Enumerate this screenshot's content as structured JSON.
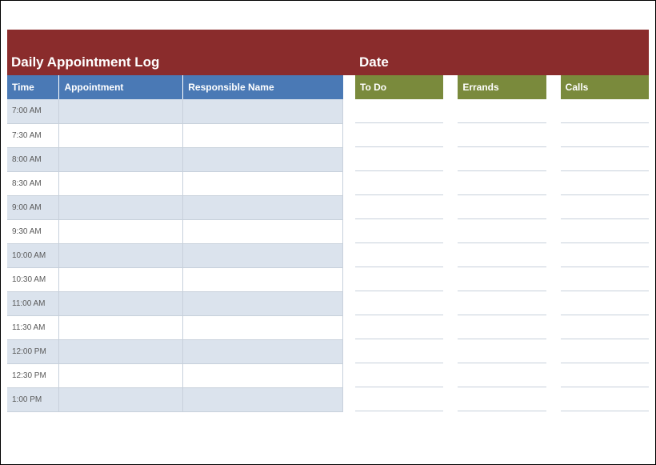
{
  "header": {
    "title": "Daily Appointment Log",
    "date_label": "Date"
  },
  "appointments": {
    "headers": {
      "time": "Time",
      "appointment": "Appointment",
      "responsible": "Responsible Name"
    },
    "rows": [
      {
        "time": "7:00 AM",
        "appointment": "",
        "responsible": ""
      },
      {
        "time": "7:30 AM",
        "appointment": "",
        "responsible": ""
      },
      {
        "time": "8:00 AM",
        "appointment": "",
        "responsible": ""
      },
      {
        "time": "8:30 AM",
        "appointment": "",
        "responsible": ""
      },
      {
        "time": "9:00 AM",
        "appointment": "",
        "responsible": ""
      },
      {
        "time": "9:30 AM",
        "appointment": "",
        "responsible": ""
      },
      {
        "time": "10:00 AM",
        "appointment": "",
        "responsible": ""
      },
      {
        "time": "10:30 AM",
        "appointment": "",
        "responsible": ""
      },
      {
        "time": "11:00 AM",
        "appointment": "",
        "responsible": ""
      },
      {
        "time": "11:30 AM",
        "appointment": "",
        "responsible": ""
      },
      {
        "time": "12:00 PM",
        "appointment": "",
        "responsible": ""
      },
      {
        "time": "12:30 PM",
        "appointment": "",
        "responsible": ""
      },
      {
        "time": "1:00 PM",
        "appointment": "",
        "responsible": ""
      }
    ]
  },
  "side": {
    "todo": {
      "label": "To Do",
      "rows": [
        "",
        "",
        "",
        "",
        "",
        "",
        "",
        "",
        "",
        "",
        "",
        "",
        ""
      ]
    },
    "errands": {
      "label": "Errands",
      "rows": [
        "",
        "",
        "",
        "",
        "",
        "",
        "",
        "",
        "",
        "",
        "",
        "",
        ""
      ]
    },
    "calls": {
      "label": "Calls",
      "rows": [
        "",
        "",
        "",
        "",
        "",
        "",
        "",
        "",
        "",
        "",
        "",
        "",
        ""
      ]
    }
  }
}
